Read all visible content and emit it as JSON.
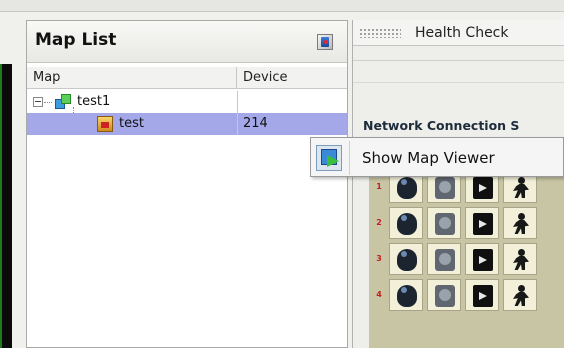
{
  "map_list": {
    "title": "Map List",
    "header_button_icon": "map-viewer-icon",
    "columns": {
      "map": "Map",
      "device": "Device"
    },
    "tree": [
      {
        "label": "test1",
        "icon": "map-group-icon",
        "device": "",
        "expanded": true
      },
      {
        "label": "test",
        "icon": "map-icon",
        "device": "214",
        "selected": true
      }
    ]
  },
  "right_panel": {
    "tab_label": "Health Check",
    "section_label": "Network Connection S",
    "grid_rows": [
      "1",
      "2",
      "3",
      "4"
    ],
    "grid_icons": [
      "camera-icon",
      "disk-icon",
      "video-icon",
      "motion-icon"
    ]
  },
  "context_menu": {
    "items": [
      {
        "label": "Show Map Viewer",
        "icon": "show-map-viewer-icon"
      }
    ]
  },
  "colors": {
    "selection": "#a4a8e8",
    "status_green": "#1f7a1f",
    "row_number": "#c02020"
  }
}
